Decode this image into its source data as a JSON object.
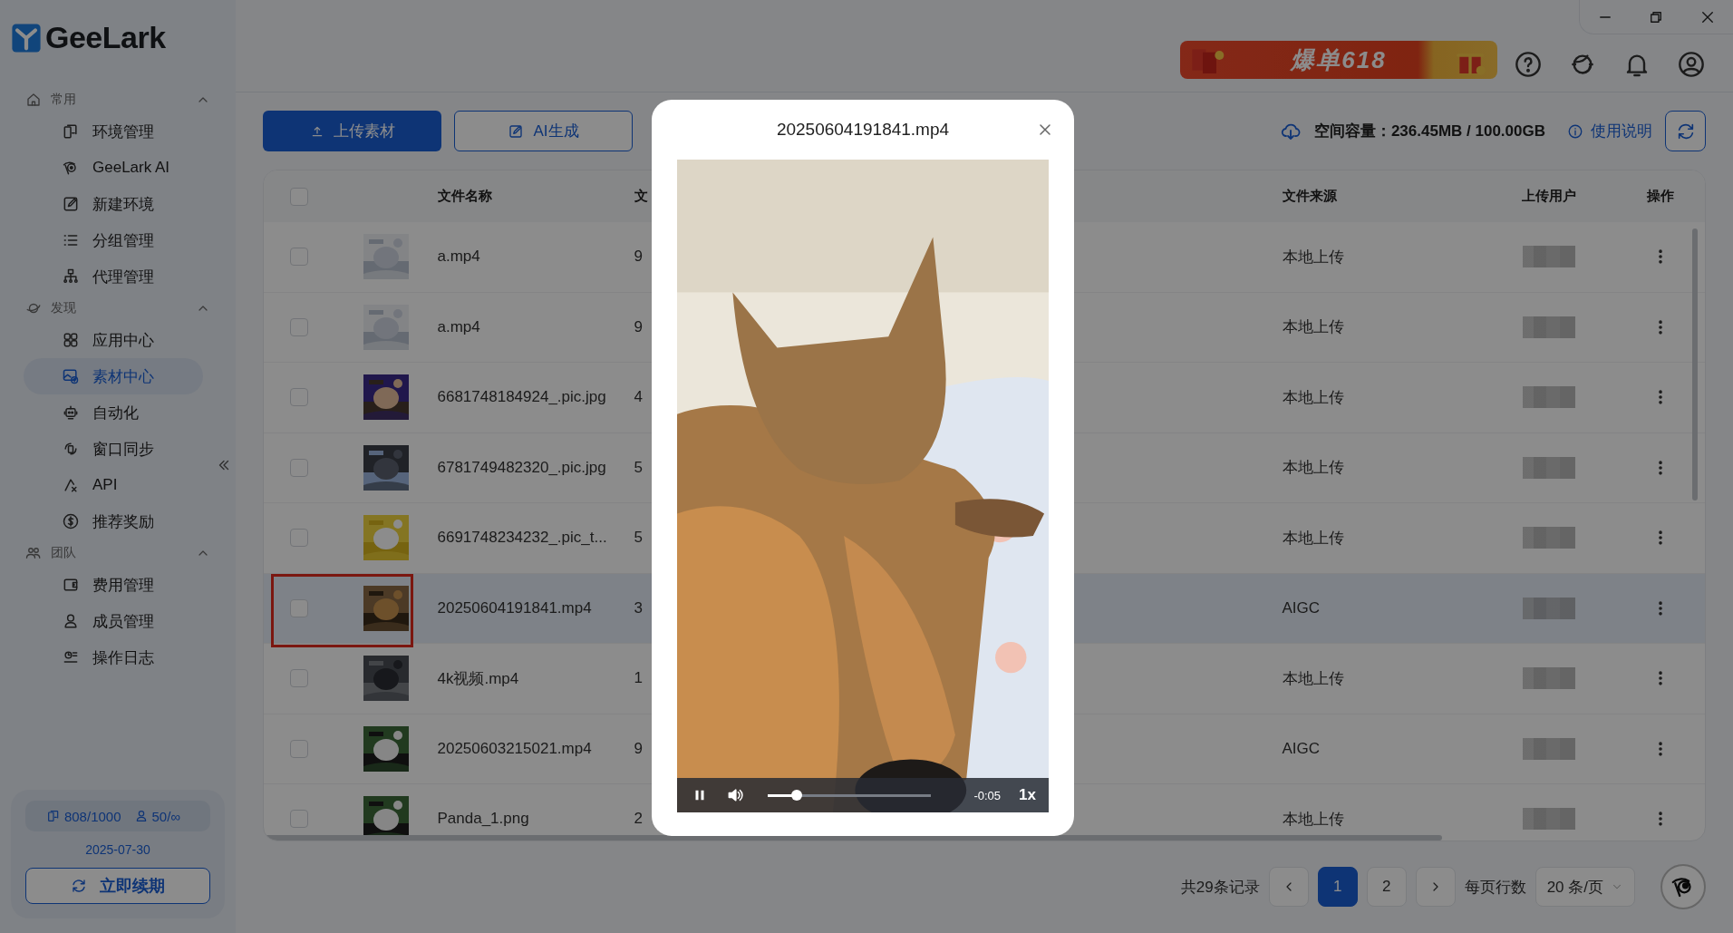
{
  "sidebar": {
    "logo": "GeeLark",
    "sections": [
      {
        "title": "常用",
        "expanded": true,
        "items": [
          {
            "label": "环境管理",
            "selected": false
          },
          {
            "label": "GeeLark AI",
            "selected": false
          },
          {
            "label": "新建环境",
            "selected": false
          },
          {
            "label": "分组管理",
            "selected": false
          },
          {
            "label": "代理管理",
            "selected": false
          }
        ]
      },
      {
        "title": "发现",
        "expanded": true,
        "items": [
          {
            "label": "应用中心",
            "selected": false
          },
          {
            "label": "素材中心",
            "selected": true
          },
          {
            "label": "自动化",
            "selected": false
          },
          {
            "label": "窗口同步",
            "selected": false
          },
          {
            "label": "API",
            "selected": false
          },
          {
            "label": "推荐奖励",
            "selected": false
          }
        ]
      },
      {
        "title": "团队",
        "expanded": true,
        "items": [
          {
            "label": "费用管理",
            "selected": false
          },
          {
            "label": "成员管理",
            "selected": false
          },
          {
            "label": "操作日志",
            "selected": false
          }
        ]
      }
    ],
    "quota": {
      "devices": "808/1000",
      "members": "50/∞",
      "expiry": "2025-07-30",
      "renew_button": "立即续期"
    }
  },
  "header": {
    "promo_banner": "爆单618"
  },
  "toolbar": {
    "buttons": [
      {
        "label": "上传素材",
        "kind": "primary"
      },
      {
        "label": "AI生成",
        "kind": "outline"
      }
    ],
    "storage": "空间容量：236.45MB / 100.00GB",
    "help_link": "使用说明"
  },
  "table": {
    "select_all": {
      "checked": false
    },
    "columns": [
      "文件名称",
      "文",
      "文件来源",
      "上传用户",
      "操作"
    ],
    "rows": [
      {
        "name": "a.mp4",
        "column_3": "9",
        "source": "本地上传",
        "checked": false,
        "selected": false,
        "highlighted": false
      },
      {
        "name": "a.mp4",
        "column_3": "9",
        "source": "本地上传",
        "checked": false,
        "selected": false,
        "highlighted": false
      },
      {
        "name": "6681748184924_.pic.jpg",
        "column_3": "4",
        "source": "本地上传",
        "checked": false,
        "selected": false,
        "highlighted": false
      },
      {
        "name": "6781749482320_.pic.jpg",
        "column_3": "5",
        "source": "本地上传",
        "checked": false,
        "selected": false,
        "highlighted": false
      },
      {
        "name": "6691748234232_.pic_t...",
        "column_3": "5",
        "source": "本地上传",
        "checked": false,
        "selected": false,
        "highlighted": false
      },
      {
        "name": "20250604191841.mp4",
        "column_3": "3",
        "source": "AIGC",
        "checked": false,
        "selected": true,
        "highlighted": true
      },
      {
        "name": "4k视频.mp4",
        "column_3": "1",
        "source": "本地上传",
        "checked": false,
        "selected": false,
        "highlighted": false
      },
      {
        "name": "20250603215021.mp4",
        "column_3": "9",
        "source": "AIGC",
        "checked": false,
        "selected": false,
        "highlighted": false
      },
      {
        "name": "Panda_1.png",
        "column_3": "2",
        "source": "本地上传",
        "checked": false,
        "selected": false,
        "highlighted": false
      }
    ]
  },
  "pagination": {
    "total": "共29条记录",
    "pages": [
      {
        "label": "1",
        "selected": true
      },
      {
        "label": "2",
        "selected": false
      }
    ],
    "page_size_label": "每页行数",
    "page_size": "20 条/页"
  },
  "video_modal": {
    "title": "20250604191841.mp4",
    "playing": true,
    "muted": false,
    "level": 0.18,
    "remaining": "-0:05",
    "speed": "1x"
  }
}
